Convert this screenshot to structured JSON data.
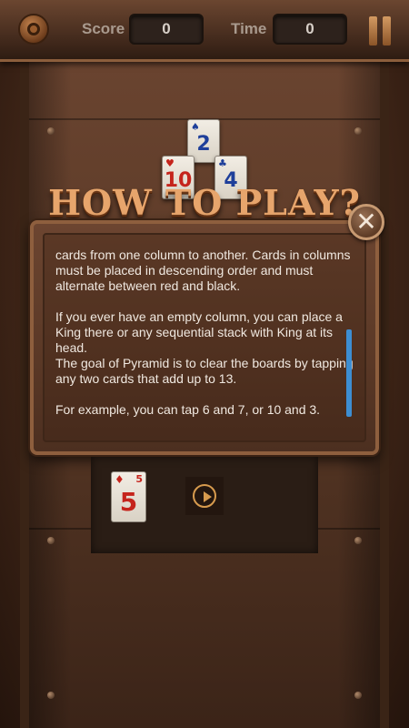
{
  "header": {
    "score_label": "Score",
    "score_value": "0",
    "time_label": "Time",
    "time_value": "0",
    "settings_icon": "gear-icon",
    "pause_icon": "pause-icon"
  },
  "pyramid_cards": [
    {
      "rank": "2",
      "suit": "♠",
      "color": "#1f3f9a"
    },
    {
      "rank": "10",
      "suit": "♥",
      "color": "#c5241c"
    },
    {
      "rank": "4",
      "suit": "♣",
      "color": "#1f3f9a"
    }
  ],
  "dialog": {
    "title": "HOW TO PLAY?",
    "close_icon": "close-icon",
    "paragraphs": [
      "cards from one column to another. Cards in columns must be placed in descending order and must alternate between red and black.",
      "If you ever have an empty column, you can place a King there or any sequential stack with King at its head.",
      "The goal of Pyramid is to clear the boards by tapping any two cards that add up to 13.",
      "For example, you can tap 6 and 7, or 10 and 3."
    ]
  },
  "demo": {
    "card_rank": "5",
    "card_suit": "♦",
    "card_color": "#c5241c",
    "play_icon": "play-icon"
  },
  "colors": {
    "accent_copper": "#e7a56c",
    "scrollbar": "#3d8ed2",
    "text": "#f0e8e0"
  }
}
